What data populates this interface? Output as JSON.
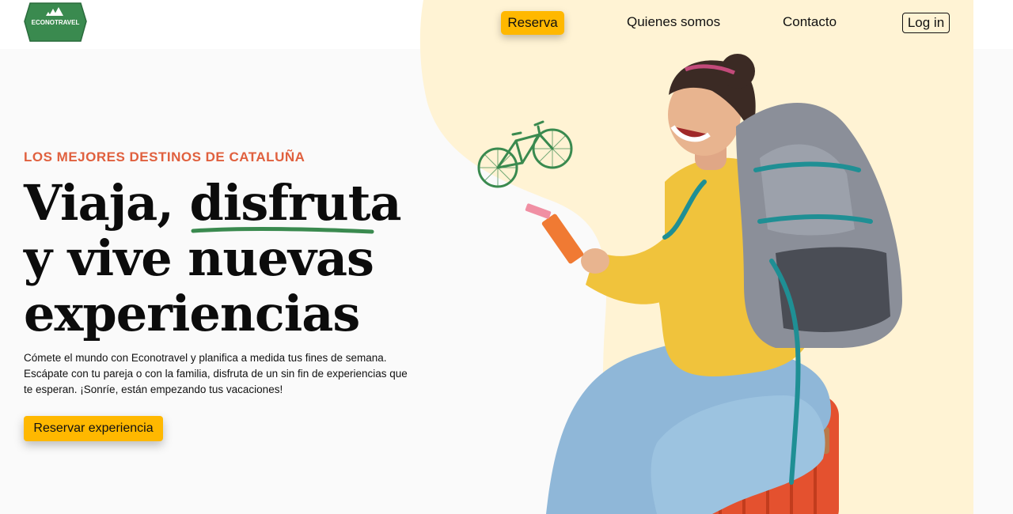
{
  "brand": {
    "logo_text": "ECONOTRAVEL"
  },
  "nav": {
    "reserva": "Reserva",
    "quienes": "Quienes somos",
    "contacto": "Contacto",
    "login": "Log in"
  },
  "hero": {
    "eyebrow": "LOS MEJORES DESTINOS DE CATALUÑA",
    "headline_line1_a": "Viaja, ",
    "headline_line1_b": "disfruta",
    "headline_line2": "y vive nuevas",
    "headline_line3": "experiencias",
    "paragraph": "Cómete el mundo con Econotravel y planifica a medida tus fines de semana. Escápate con tu pareja o con la familia, disfruta de un sin fin de experiencias que te esperan. ¡Sonríe, están empezando tus vacaciones!",
    "cta": "Reservar experiencia"
  },
  "colors": {
    "accent": "#ffb800",
    "eyebrow": "#e0603e",
    "brand_green": "#3a8a4f",
    "cream": "#fff3d4"
  }
}
